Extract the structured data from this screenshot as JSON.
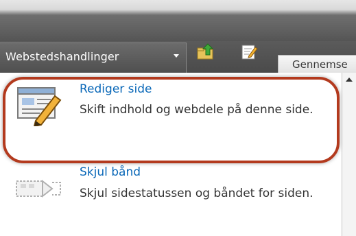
{
  "header": {
    "site_actions_label": "Webstedshandlinger",
    "browse_tab_label": "Gennemse",
    "icons": [
      "navigate-up-icon",
      "edit-page-icon"
    ]
  },
  "menu": {
    "items": [
      {
        "title": "Rediger side",
        "description": "Skift indhold og webdele på denne side.",
        "icon": "edit-page-icon"
      },
      {
        "title": "Skjul bånd",
        "description": "Skjul sidestatussen og båndet for siden.",
        "icon": "hide-ribbon-icon"
      }
    ]
  },
  "colors": {
    "link": "#0a68b8",
    "highlight": "#b33a1e",
    "dark_bar": "#4f4f4f"
  }
}
